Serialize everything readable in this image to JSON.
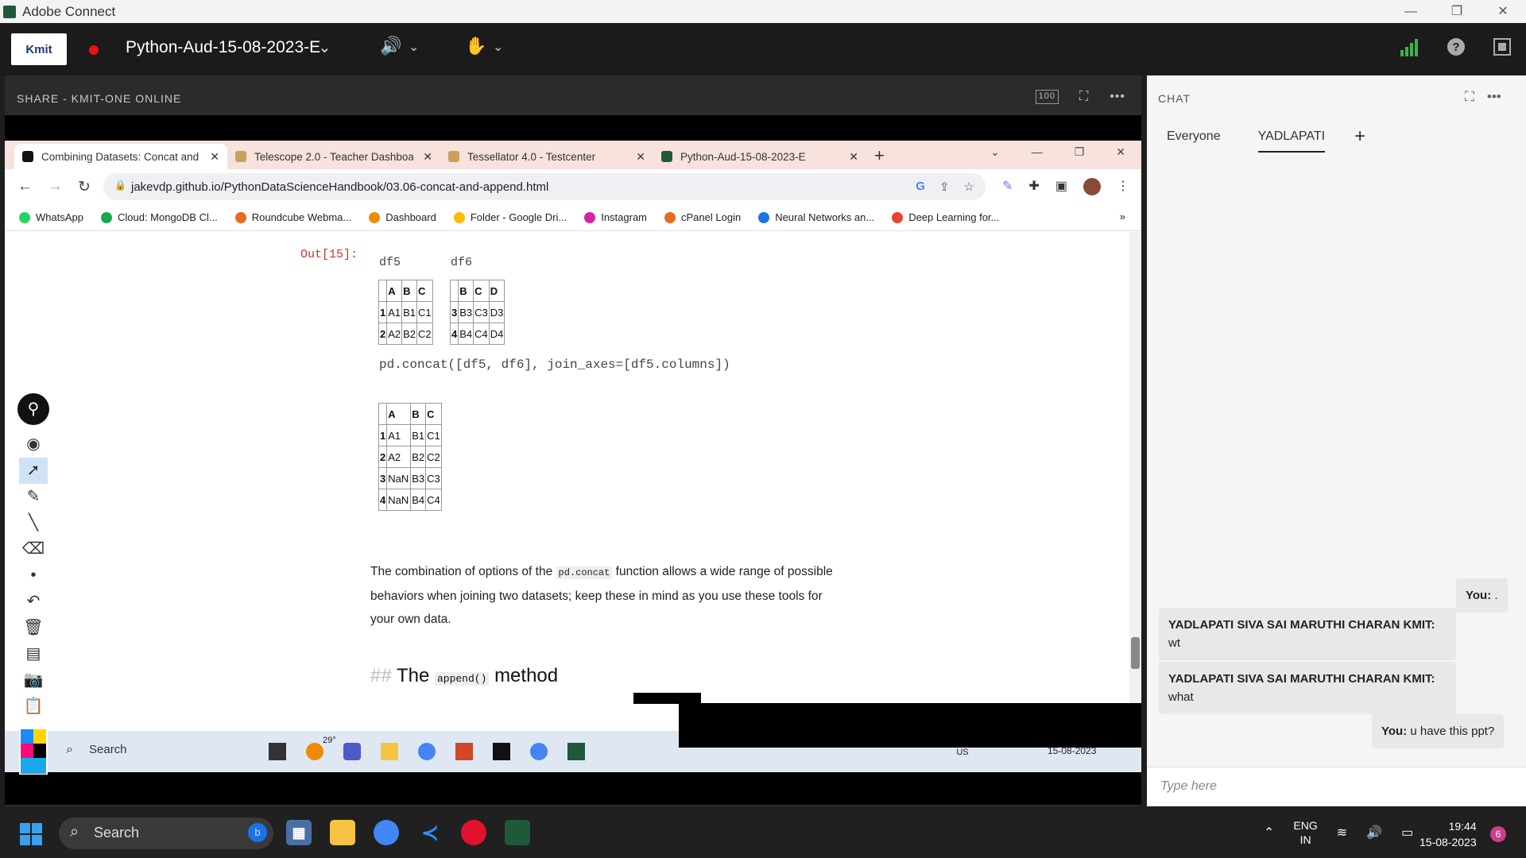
{
  "window": {
    "title": "Adobe Connect",
    "minimize": "—",
    "restore": "❐",
    "close": "✕"
  },
  "topbar": {
    "logo": "Kmit",
    "meeting": "Python-Aud-15-08-2023-E",
    "chevron": "⌄"
  },
  "share": {
    "header": "SHARE  - KMIT-ONE ONLINE",
    "zoom_label": "100"
  },
  "browser": {
    "tabs": [
      {
        "label": "Combining Datasets: Concat and",
        "color": "#111111"
      },
      {
        "label": "Telescope 2.0 - Teacher Dashboa",
        "color": "#c9a15a"
      },
      {
        "label": "Tessellator 4.0 - Testcenter",
        "color": "#c9a15a"
      },
      {
        "label": "Python-Aud-15-08-2023-E",
        "color": "#1e5a3a"
      }
    ],
    "new_tab": "+",
    "url": "jakevdp.github.io/PythonDataScienceHandbook/03.06-concat-and-append.html",
    "bookmarks": [
      {
        "label": "WhatsApp",
        "color": "#25d366"
      },
      {
        "label": "Cloud: MongoDB Cl...",
        "color": "#13aa52"
      },
      {
        "label": "Roundcube Webma...",
        "color": "#e86a1f"
      },
      {
        "label": "Dashboard",
        "color": "#f08a00"
      },
      {
        "label": "Folder - Google Dri...",
        "color": "#fbbc04"
      },
      {
        "label": "Instagram",
        "color": "#d6249f"
      },
      {
        "label": "cPanel Login",
        "color": "#e86a1f"
      },
      {
        "label": "Neural Networks an...",
        "color": "#1a73e8"
      },
      {
        "label": "Deep Learning for...",
        "color": "#ea4335"
      }
    ],
    "more": "»"
  },
  "notebook": {
    "out_label": "Out[15]:",
    "df5_label": "df5",
    "df6_label": "df6",
    "df5": {
      "cols": [
        "",
        "A",
        "B",
        "C"
      ],
      "rows": [
        [
          "1",
          "A1",
          "B1",
          "C1"
        ],
        [
          "2",
          "A2",
          "B2",
          "C2"
        ]
      ]
    },
    "df6": {
      "cols": [
        "",
        "B",
        "C",
        "D"
      ],
      "rows": [
        [
          "3",
          "B3",
          "C3",
          "D3"
        ],
        [
          "4",
          "B4",
          "C4",
          "D4"
        ]
      ]
    },
    "code": "pd.concat([df5, df6], join_axes=[df5.columns])",
    "result": {
      "cols": [
        "",
        "A",
        "B",
        "C"
      ],
      "rows": [
        [
          "1",
          "A1",
          "B1",
          "C1"
        ],
        [
          "2",
          "A2",
          "B2",
          "C2"
        ],
        [
          "3",
          "NaN",
          "B3",
          "C3"
        ],
        [
          "4",
          "NaN",
          "B4",
          "C4"
        ]
      ]
    },
    "para_1": "The combination of options of the",
    "para_code": "pd.concat",
    "para_2": "function allows a wide range of possible behaviors when joining two datasets; keep these in mind as you use these tools for your own data.",
    "heading_hash": "##",
    "heading_1": "The",
    "heading_code": "append()",
    "heading_2": "method"
  },
  "inner_taskbar": {
    "search": "Search",
    "temp": "29°",
    "lang": "ENG US",
    "date": "15-08-2023"
  },
  "chat": {
    "header": "CHAT",
    "tabs": [
      "Everyone",
      "YADLAPATI"
    ],
    "add": "+",
    "messages": [
      {
        "from": "You:",
        "text": ".",
        "mine": true
      },
      {
        "from": "YADLAPATI SIVA SAI MARUTHI CHARAN KMIT:",
        "text": "wt",
        "mine": false
      },
      {
        "from": "YADLAPATI SIVA SAI MARUTHI CHARAN KMIT:",
        "text": "what",
        "mine": false
      },
      {
        "from": "You:",
        "text": "u have this ppt?",
        "mine": true
      }
    ],
    "placeholder": "Type here"
  },
  "taskbar": {
    "search": "Search",
    "lang": "ENG",
    "region": "IN",
    "time": "19:44",
    "date": "15-08-2023",
    "notifications": "6"
  }
}
